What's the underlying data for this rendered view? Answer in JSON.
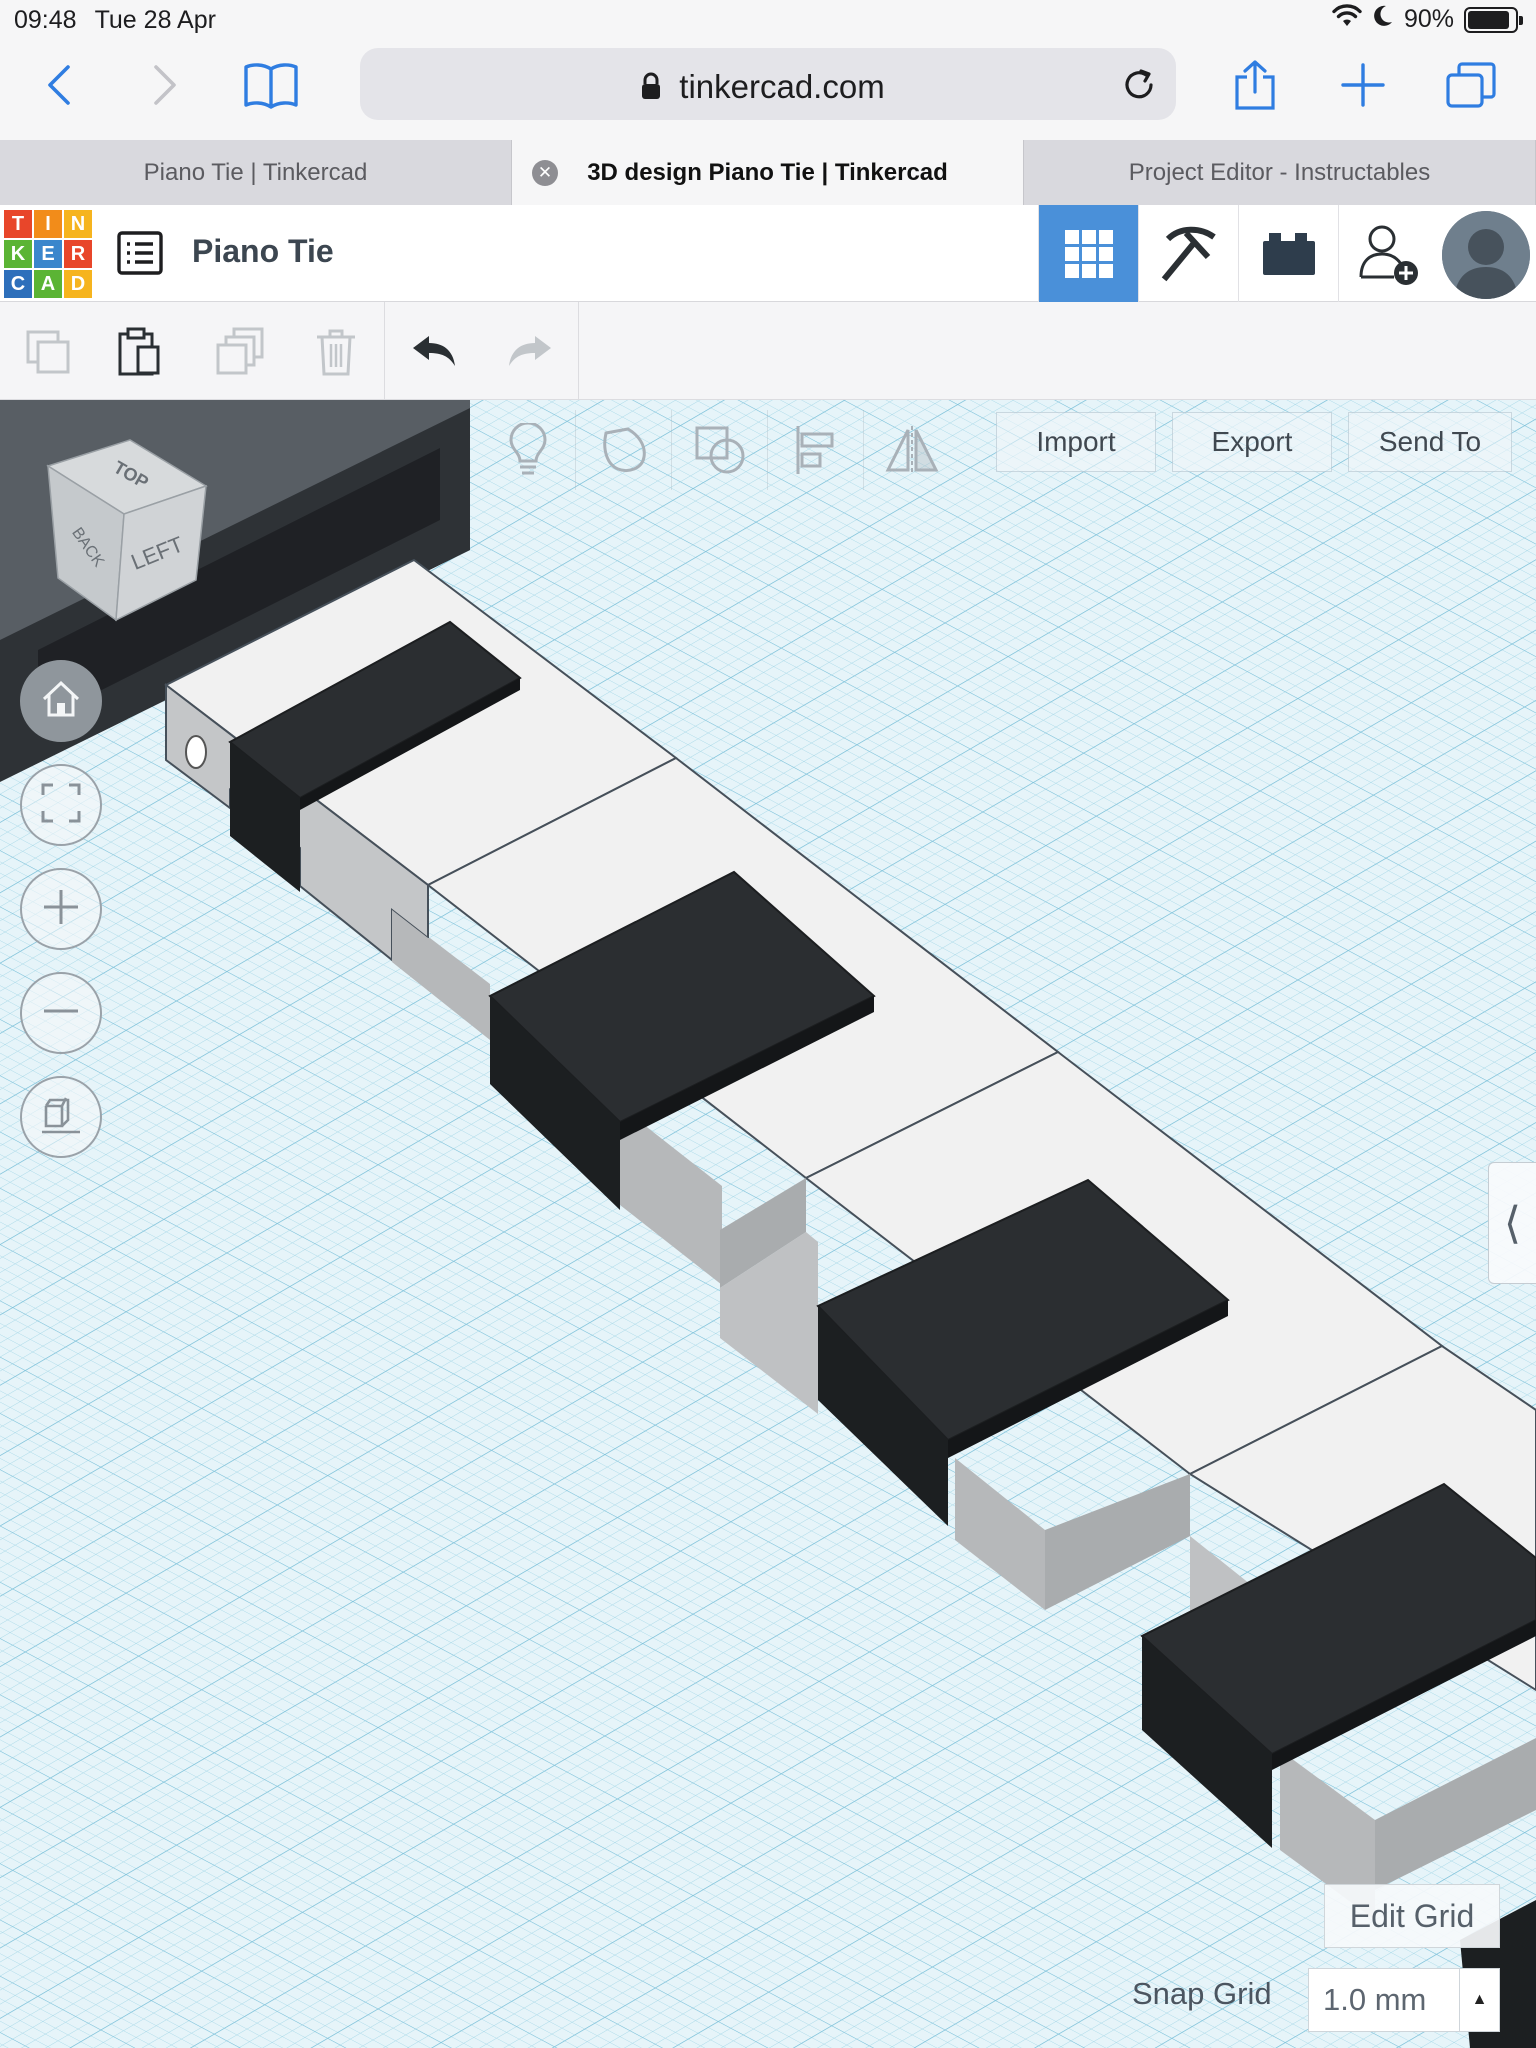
{
  "status_bar": {
    "time": "09:48",
    "date": "Tue 28 Apr",
    "battery": "90%",
    "battery_level": 0.9
  },
  "browser": {
    "url": "tinkercad.com",
    "icons": [
      "back-icon",
      "forward-icon",
      "bookmarks-icon",
      "lock-icon",
      "reload-icon",
      "share-icon",
      "new-tab-icon",
      "tabs-icon"
    ]
  },
  "tabs": [
    {
      "label": "Piano Tie | Tinkercad"
    },
    {
      "label": "3D design Piano Tie | Tinkercad",
      "active": true
    },
    {
      "label": "Project Editor - Instructables"
    }
  ],
  "header": {
    "logo_letters": [
      "T",
      "I",
      "N",
      "K",
      "E",
      "R",
      "C",
      "A",
      "D"
    ],
    "logo_colors": [
      "#e8462a",
      "#f28c1a",
      "#f6b41e",
      "#5bb434",
      "#3a86cc",
      "#e8462a",
      "#2d6fbb",
      "#5bb434",
      "#f6b41e"
    ],
    "design_name": "Piano Tie",
    "accent_color": "#4a90d9"
  },
  "workplane": {
    "view_cube": {
      "top": "TOP",
      "back": "BACK",
      "left": "LEFT"
    },
    "buttons": {
      "import": "Import",
      "export": "Export",
      "send_to": "Send To"
    },
    "edit_grid": "Edit Grid",
    "snap_grid_label": "Snap Grid",
    "snap_grid_value": "1.0 mm",
    "side_tab_glyph": "⟨"
  }
}
